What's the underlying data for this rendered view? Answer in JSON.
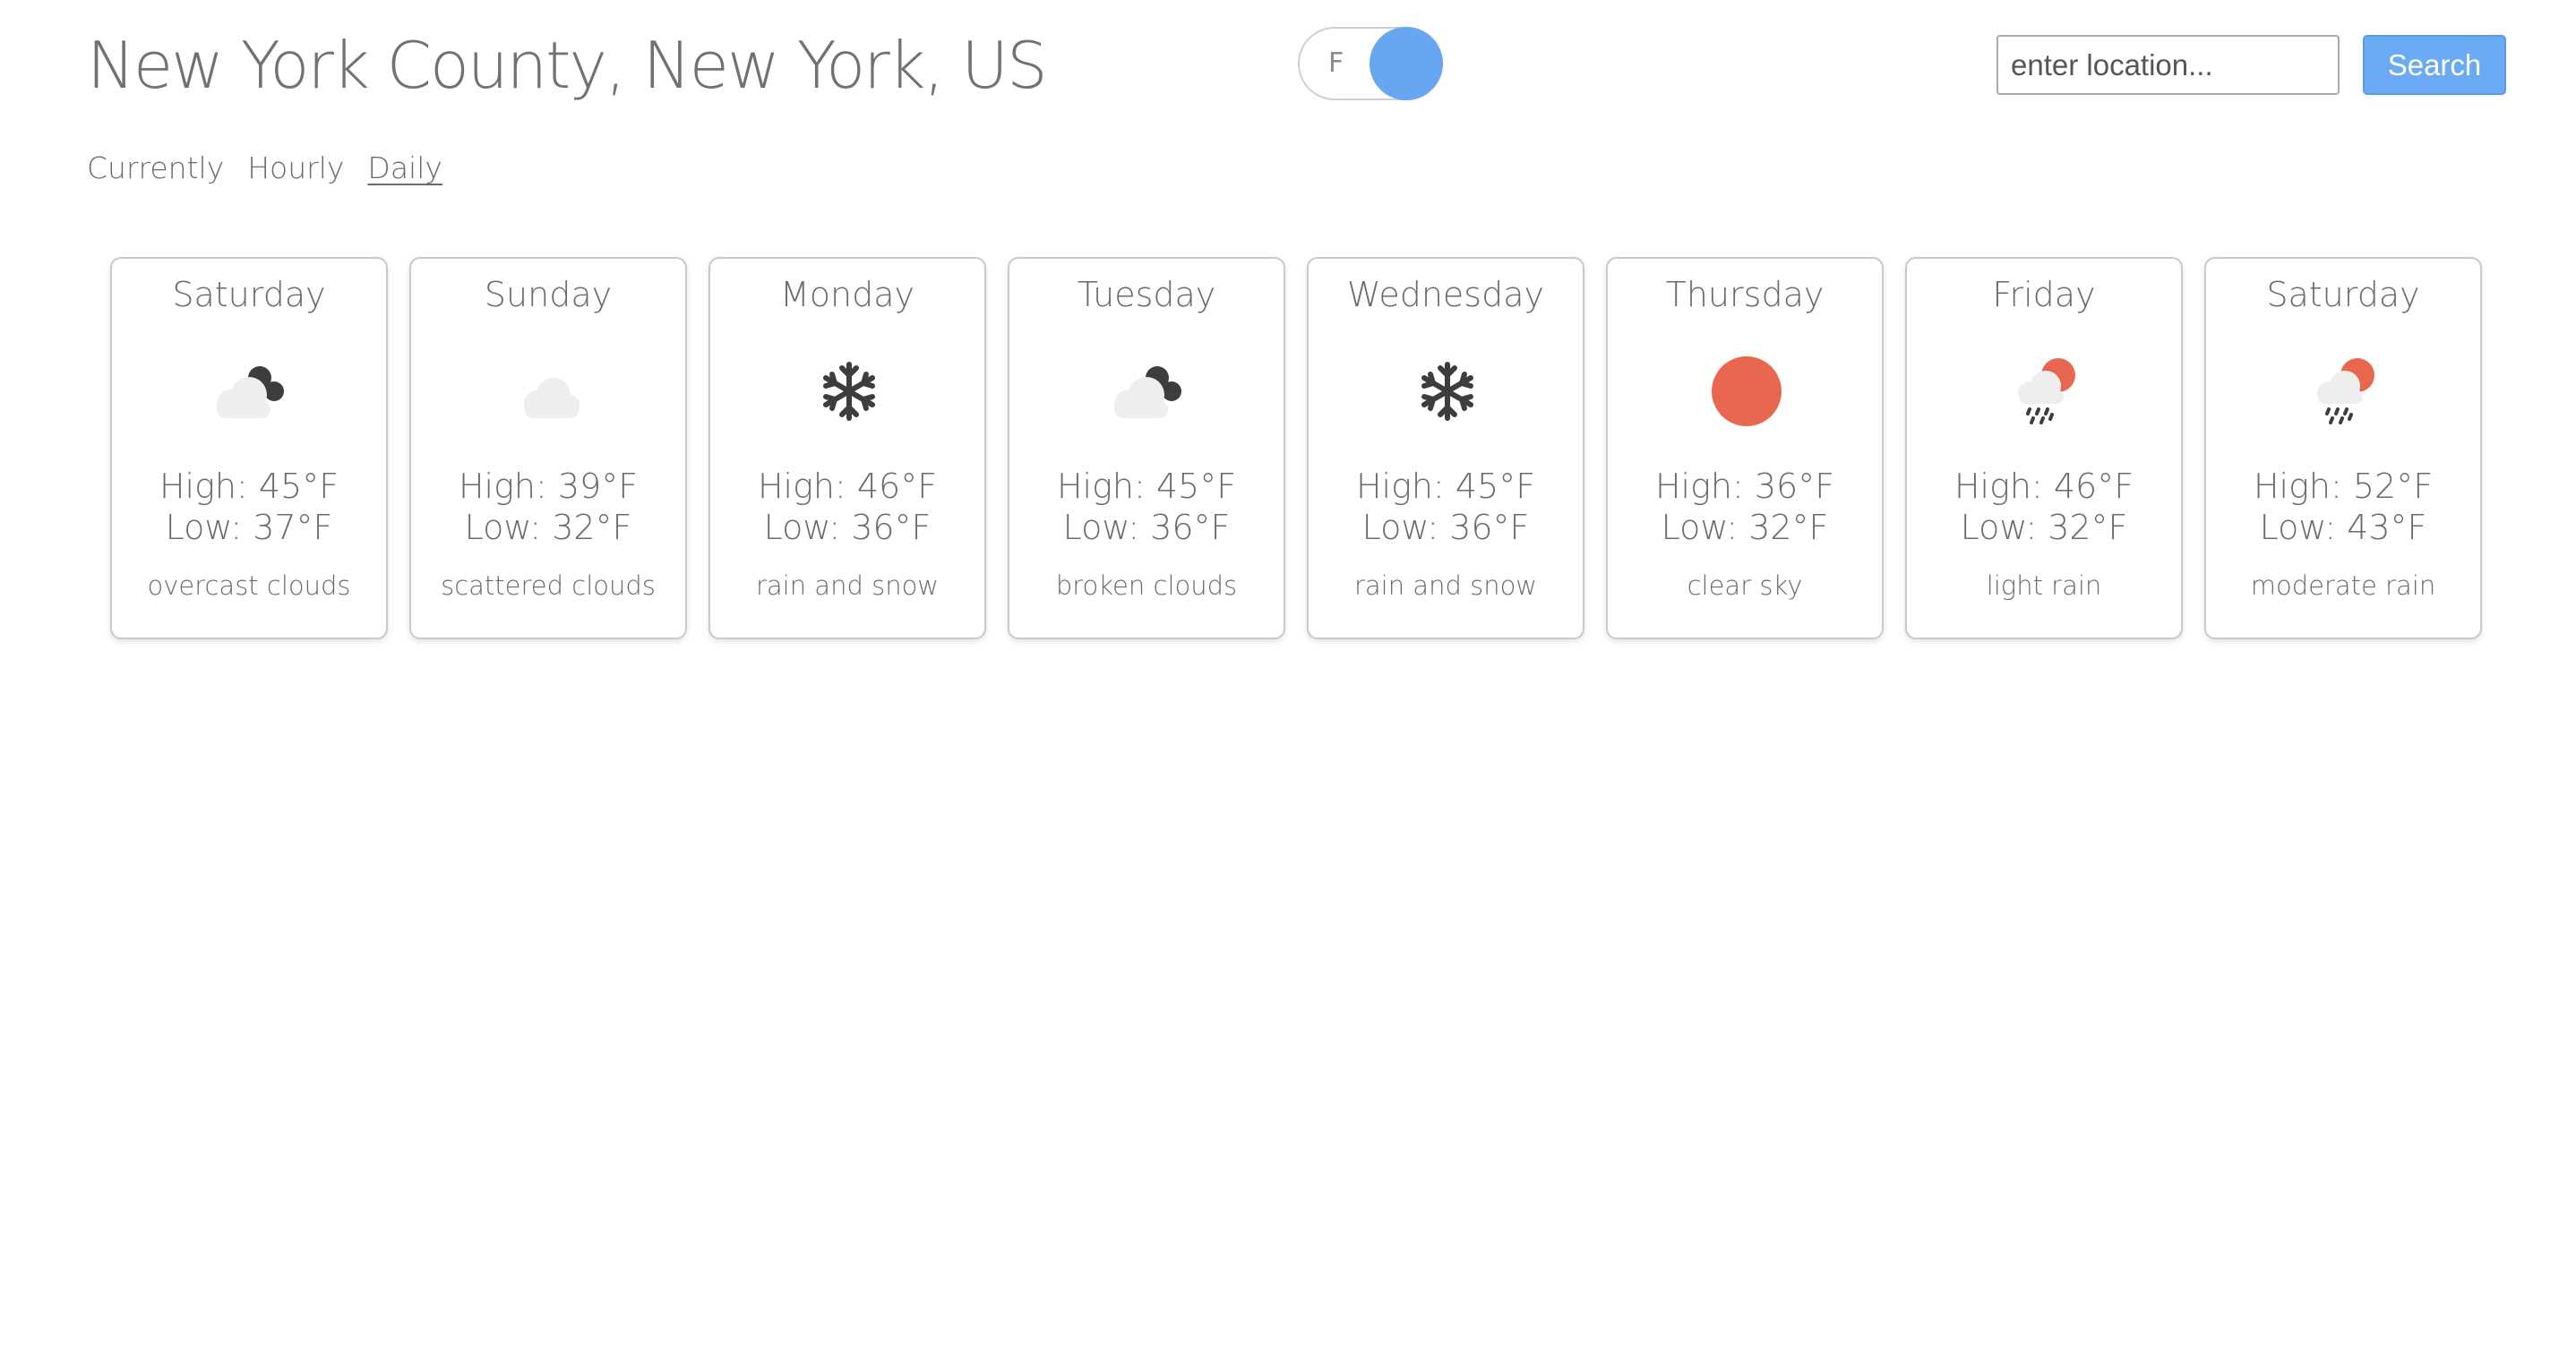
{
  "header": {
    "location": "New York County, New York, US",
    "unit_toggle_label": "F",
    "search_placeholder": "enter location...",
    "search_button_label": "Search"
  },
  "nav": {
    "tabs": [
      {
        "label": "Currently",
        "active": false
      },
      {
        "label": "Hourly",
        "active": false
      },
      {
        "label": "Daily",
        "active": true
      }
    ]
  },
  "forecast": {
    "days": [
      {
        "day": "Saturday",
        "high": "High: 45°F",
        "low": "Low: 37°F",
        "description": "overcast clouds",
        "icon": "overcast-clouds-icon"
      },
      {
        "day": "Sunday",
        "high": "High: 39°F",
        "low": "Low: 32°F",
        "description": "scattered clouds",
        "icon": "cloud-icon"
      },
      {
        "day": "Monday",
        "high": "High: 46°F",
        "low": "Low: 36°F",
        "description": "rain and snow",
        "icon": "snowflake-icon"
      },
      {
        "day": "Tuesday",
        "high": "High: 45°F",
        "low": "Low: 36°F",
        "description": "broken clouds",
        "icon": "overcast-clouds-icon"
      },
      {
        "day": "Wednesday",
        "high": "High: 45°F",
        "low": "Low: 36°F",
        "description": "rain and snow",
        "icon": "snowflake-icon"
      },
      {
        "day": "Thursday",
        "high": "High: 36°F",
        "low": "Low: 32°F",
        "description": "clear sky",
        "icon": "sun-icon"
      },
      {
        "day": "Friday",
        "high": "High: 46°F",
        "low": "Low: 32°F",
        "description": "light rain",
        "icon": "sun-rain-icon"
      },
      {
        "day": "Saturday",
        "high": "High: 52°F",
        "low": "Low: 43°F",
        "description": "moderate rain",
        "icon": "sun-rain-icon"
      }
    ]
  },
  "colors": {
    "accent": "#6aa9f4",
    "toggle_knob": "#68a6f2",
    "sun": "#e8684f",
    "cloud_light": "#eeeeee",
    "cloud_dark": "#3d3d3d",
    "text": "#6a6a6a"
  }
}
